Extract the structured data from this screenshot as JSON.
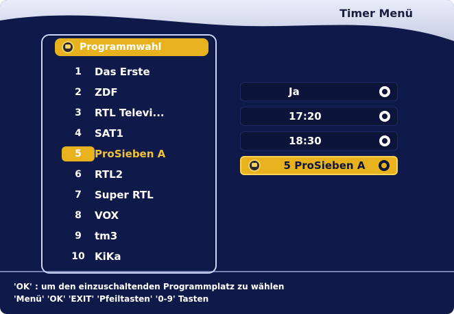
{
  "header": {
    "title": "Timer Menü"
  },
  "programm": {
    "title": "Programmwahl",
    "items": [
      {
        "num": "1",
        "name": "Das Erste"
      },
      {
        "num": "2",
        "name": "ZDF"
      },
      {
        "num": "3",
        "name": "RTL Televi..."
      },
      {
        "num": "4",
        "name": "SAT1"
      },
      {
        "num": "5",
        "name": "ProSieben A"
      },
      {
        "num": "6",
        "name": "RTL2"
      },
      {
        "num": "7",
        "name": "Super RTL"
      },
      {
        "num": "8",
        "name": "VOX"
      },
      {
        "num": "9",
        "name": "tm3"
      },
      {
        "num": "10",
        "name": "KiKa"
      }
    ],
    "selected_index": 4
  },
  "timer": {
    "repeat": "Ja",
    "start_time": "17:20",
    "end_time": "18:30",
    "program_selected": "5 ProSieben A"
  },
  "footer": {
    "line1": "'OK' : um den einzuschaltenden Programmplatz zu wählen",
    "line2": "'Menü' 'OK' 'EXIT' 'Pfeiltasten' '0-9' Tasten"
  },
  "colors": {
    "background": "#0f1a4a",
    "accent": "#e7b21e",
    "text": "#ffffff"
  }
}
